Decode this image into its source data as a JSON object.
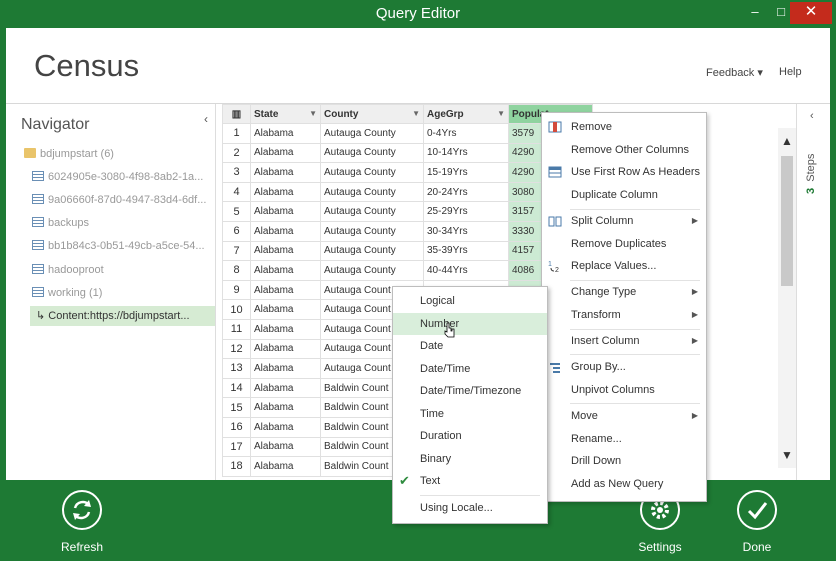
{
  "window": {
    "title": "Query Editor",
    "minimize": "–",
    "maximize": "□",
    "close": "✕"
  },
  "header": {
    "title": "Census",
    "feedback_label": "Feedback ▾",
    "help_label": "Help"
  },
  "navigator": {
    "title": "Navigator",
    "collapse": "‹",
    "items": [
      {
        "label": "bdjumpstart (6)",
        "icon": "folder-icon"
      },
      {
        "label": "6024905e-3080-4f98-8ab2-1a...",
        "icon": "table-icon"
      },
      {
        "label": "9a06660f-87d0-4947-83d4-6df...",
        "icon": "table-icon"
      },
      {
        "label": "backups",
        "icon": "table-icon"
      },
      {
        "label": "bb1b84c3-0b51-49cb-a5ce-54...",
        "icon": "table-icon"
      },
      {
        "label": "hadooproot",
        "icon": "table-icon"
      },
      {
        "label": "working (1)",
        "icon": "table-icon"
      },
      {
        "label": "↳ Content:https://bdjumpstart...",
        "icon": ""
      }
    ]
  },
  "grid": {
    "columns": [
      "State",
      "County",
      "AgeGrp",
      "Populat"
    ],
    "rows": [
      [
        "1",
        "Alabama",
        "Autauga County",
        "0-4Yrs",
        "3579"
      ],
      [
        "2",
        "Alabama",
        "Autauga County",
        "10-14Yrs",
        "4290"
      ],
      [
        "3",
        "Alabama",
        "Autauga County",
        "15-19Yrs",
        "4290"
      ],
      [
        "4",
        "Alabama",
        "Autauga County",
        "20-24Yrs",
        "3080"
      ],
      [
        "5",
        "Alabama",
        "Autauga County",
        "25-29Yrs",
        "3157"
      ],
      [
        "6",
        "Alabama",
        "Autauga County",
        "30-34Yrs",
        "3330"
      ],
      [
        "7",
        "Alabama",
        "Autauga County",
        "35-39Yrs",
        "4157"
      ],
      [
        "8",
        "Alabama",
        "Autauga County",
        "40-44Yrs",
        "4086"
      ],
      [
        "9",
        "Alabama",
        "Autauga Count",
        "",
        ""
      ],
      [
        "10",
        "Alabama",
        "Autauga Count",
        "",
        ""
      ],
      [
        "11",
        "Alabama",
        "Autauga Count",
        "",
        ""
      ],
      [
        "12",
        "Alabama",
        "Autauga Count",
        "",
        ""
      ],
      [
        "13",
        "Alabama",
        "Autauga Count",
        "",
        ""
      ],
      [
        "14",
        "Alabama",
        "Baldwin Count",
        "",
        ""
      ],
      [
        "15",
        "Alabama",
        "Baldwin Count",
        "",
        ""
      ],
      [
        "16",
        "Alabama",
        "Baldwin Count",
        "",
        ""
      ],
      [
        "17",
        "Alabama",
        "Baldwin Count",
        "",
        ""
      ],
      [
        "18",
        "Alabama",
        "Baldwin Count",
        "",
        ""
      ]
    ]
  },
  "steps": {
    "count": "3",
    "label": "Steps",
    "collapse": "‹"
  },
  "context_menu": {
    "items": [
      {
        "label": "Remove",
        "icon": "remove-column-icon",
        "submenu": false
      },
      {
        "label": "Remove Other Columns",
        "icon": "",
        "submenu": false
      },
      {
        "label": "Use First Row As Headers",
        "icon": "table-header-icon",
        "submenu": false
      },
      {
        "label": "Duplicate Column",
        "icon": "",
        "submenu": false
      },
      {
        "label": "Split Column",
        "icon": "split-column-icon",
        "submenu": true
      },
      {
        "label": "Remove Duplicates",
        "icon": "",
        "submenu": false
      },
      {
        "label": "Replace Values...",
        "icon": "replace-values-icon",
        "submenu": false
      },
      {
        "label": "Change Type",
        "icon": "",
        "submenu": true
      },
      {
        "label": "Transform",
        "icon": "",
        "submenu": true
      },
      {
        "label": "Insert Column",
        "icon": "",
        "submenu": true
      },
      {
        "label": "Group By...",
        "icon": "group-by-icon",
        "submenu": false
      },
      {
        "label": "Unpivot Columns",
        "icon": "",
        "submenu": false
      },
      {
        "label": "Move",
        "icon": "",
        "submenu": true
      },
      {
        "label": "Rename...",
        "icon": "",
        "submenu": false
      },
      {
        "label": "Drill Down",
        "icon": "",
        "submenu": false
      },
      {
        "label": "Add as New Query",
        "icon": "",
        "submenu": false
      }
    ]
  },
  "type_menu": {
    "items": [
      "Logical",
      "Number",
      "Date",
      "Date/Time",
      "Date/Time/Timezone",
      "Time",
      "Duration",
      "Binary",
      "Text",
      "Using Locale..."
    ],
    "highlighted": "Number",
    "checked": "Text"
  },
  "ribbon": {
    "refresh_label": "Refresh",
    "settings_label": "Settings",
    "done_label": "Done"
  },
  "colors": {
    "brand": "#1e7a34",
    "selected_column": "#8fd39f",
    "highlight": "#d9eedb"
  }
}
